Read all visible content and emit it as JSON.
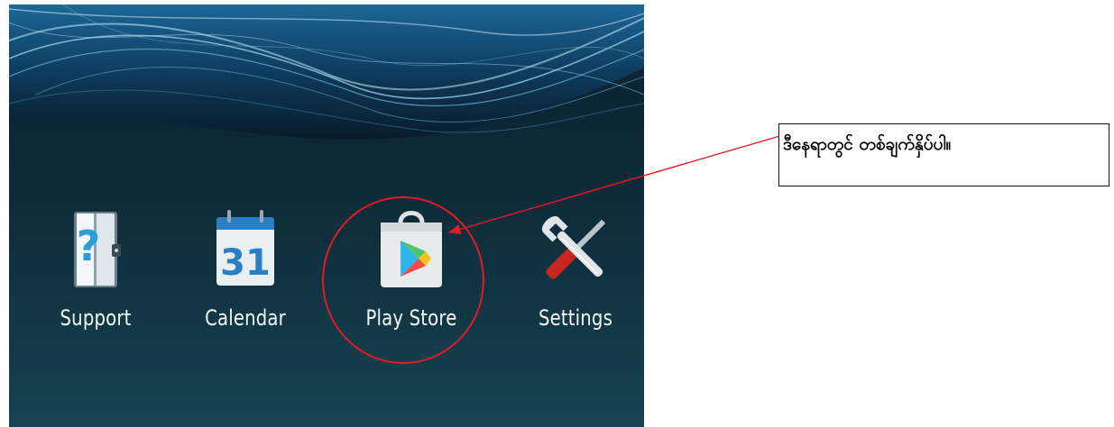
{
  "home_screen": {
    "apps": [
      {
        "label": "Support",
        "icon": "support-book-icon"
      },
      {
        "label": "Calendar",
        "icon": "calendar-icon",
        "date": "31"
      },
      {
        "label": "Play Store",
        "icon": "play-store-icon"
      },
      {
        "label": "Settings",
        "icon": "settings-tools-icon"
      }
    ]
  },
  "annotation": {
    "text": "ဒီနေရာတွင် တစ်ချက်နှိပ်ပါ။",
    "color": "#e11b22"
  }
}
